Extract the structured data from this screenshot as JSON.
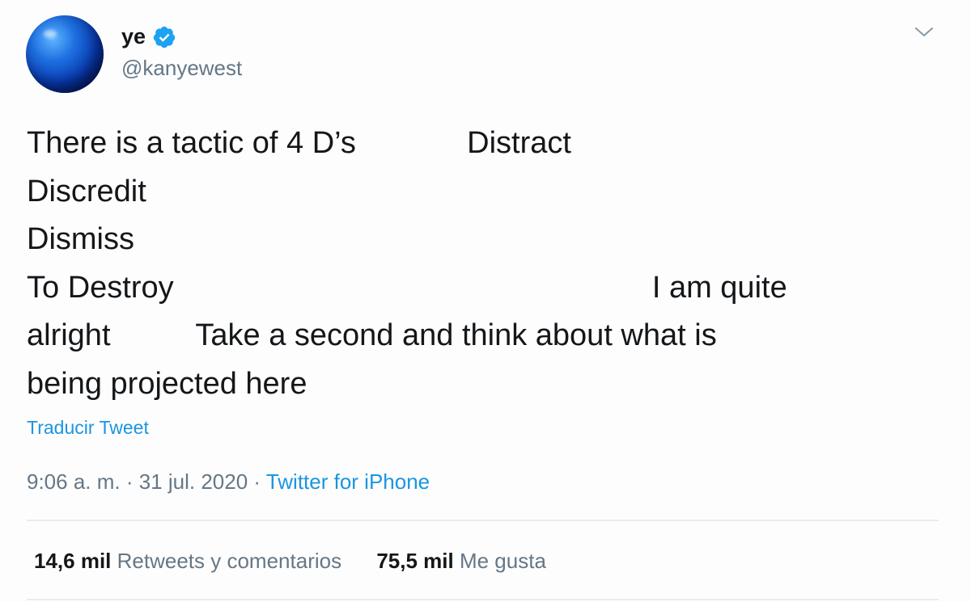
{
  "user": {
    "display_name": "ye",
    "handle": "@kanyewest",
    "verified_icon": "verified-badge-icon",
    "avatar_icon": "avatar-blue-sphere"
  },
  "menu": {
    "caret_icon": "chevron-down-icon"
  },
  "tweet": {
    "text": "There is a tactic of 4 D’s             Distract\nDiscredit\nDismiss\nTo Destroy                                                        I am quite\nalright          Take a second and think about what is\nbeing projected here",
    "translate_label": "Traducir Tweet"
  },
  "meta": {
    "time": "9:06 a. m.",
    "separator": " · ",
    "date": "31 jul. 2020",
    "source": "Twitter for iPhone"
  },
  "stats": {
    "retweets_count": "14,6 mil",
    "retweets_label": "Retweets y comentarios",
    "likes_count": "75,5 mil",
    "likes_label": "Me gusta"
  },
  "colors": {
    "link": "#1b95e0",
    "secondary_text": "#657786",
    "primary_text": "#14171a",
    "divider": "#e6ecf0"
  }
}
